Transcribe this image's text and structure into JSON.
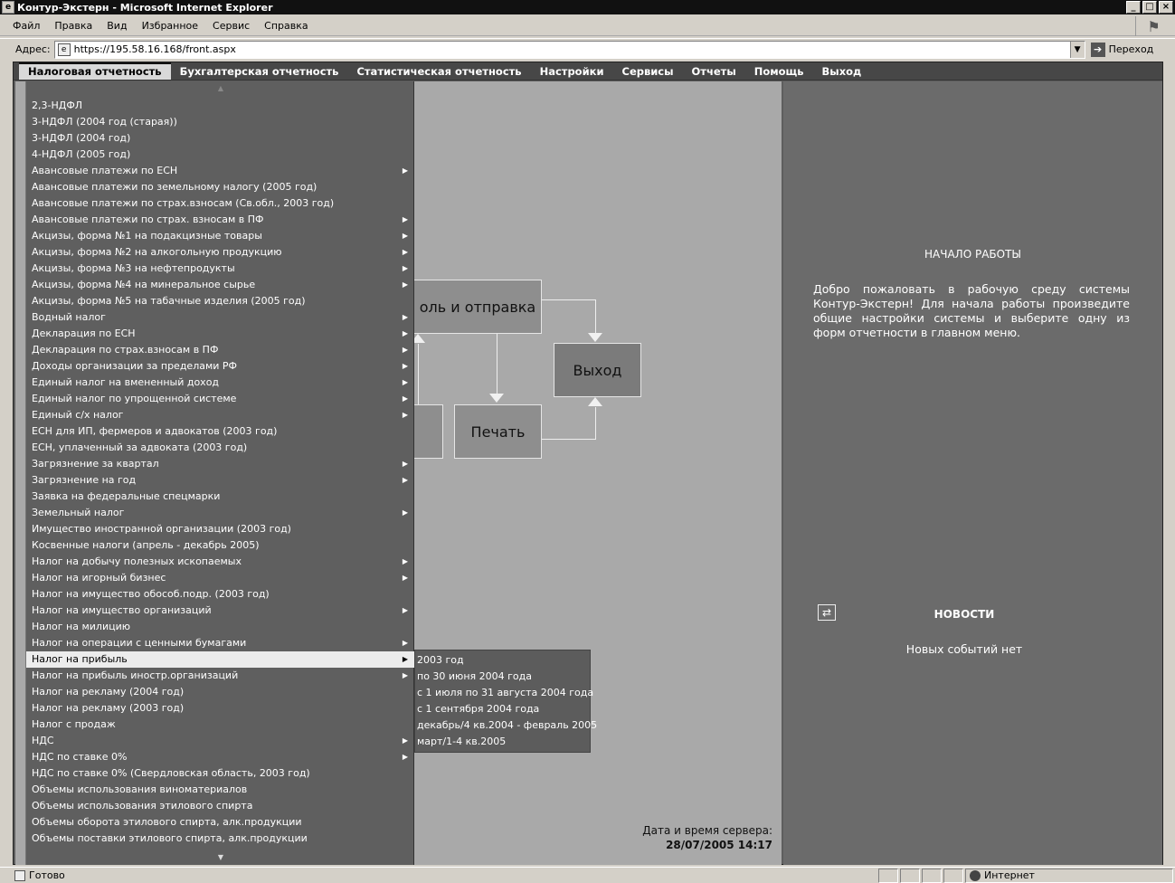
{
  "window": {
    "title": "Контур-Экстерн - Microsoft Internet Explorer",
    "min": "_",
    "max": "□",
    "close": "×"
  },
  "browser_menu": [
    "Файл",
    "Правка",
    "Вид",
    "Избранное",
    "Сервис",
    "Справка"
  ],
  "address": {
    "label": "Адрес:",
    "url": "https://195.58.16.168/front.aspx",
    "go_label": "Переход"
  },
  "top_nav": [
    "Налоговая отчетность",
    "Бухгалтерская отчетность",
    "Статистическая отчетность",
    "Настройки",
    "Сервисы",
    "Отчеты",
    "Помощь",
    "Выход"
  ],
  "diagram": {
    "control_send": "оль и отправка",
    "exit": "Выход",
    "print": "Печать"
  },
  "server_time": {
    "label": "Дата и время сервера:",
    "value": "28/07/2005 14:17"
  },
  "start_panel": {
    "title": "НАЧАЛО РАБОТЫ",
    "text": "Добро пожаловать в рабочую среду системы Контур-Экстерн! Для начала работы произведите общие настройки системы и выберите одну из форм отчетности в главном меню."
  },
  "news": {
    "title": "НОВОСТИ",
    "text": "Новых событий нет"
  },
  "tax_menu": [
    {
      "label": "2,3-НДФЛ",
      "sub": false
    },
    {
      "label": "3-НДФЛ (2004 год (старая))",
      "sub": false
    },
    {
      "label": "3-НДФЛ (2004 год)",
      "sub": false
    },
    {
      "label": "4-НДФЛ (2005 год)",
      "sub": false
    },
    {
      "label": "Авансовые платежи по ЕСН",
      "sub": true
    },
    {
      "label": "Авансовые платежи по земельному налогу (2005 год)",
      "sub": false
    },
    {
      "label": "Авансовые платежи по страх.взносам (Св.обл., 2003 год)",
      "sub": false
    },
    {
      "label": "Авансовые платежи по страх. взносам в ПФ",
      "sub": true
    },
    {
      "label": "Акцизы, форма №1 на подакцизные товары",
      "sub": true
    },
    {
      "label": "Акцизы, форма №2 на алкогольную продукцию",
      "sub": true
    },
    {
      "label": "Акцизы, форма №3 на нефтепродукты",
      "sub": true
    },
    {
      "label": "Акцизы, форма №4 на минеральное сырье",
      "sub": true
    },
    {
      "label": "Акцизы, форма №5 на табачные изделия (2005 год)",
      "sub": false
    },
    {
      "label": "Водный налог",
      "sub": true
    },
    {
      "label": "Декларация по ЕСН",
      "sub": true
    },
    {
      "label": "Декларация по страх.взносам в ПФ",
      "sub": true
    },
    {
      "label": "Доходы организации за пределами РФ",
      "sub": true
    },
    {
      "label": "Единый налог на вмененный доход",
      "sub": true
    },
    {
      "label": "Единый налог по упрощенной системе",
      "sub": true
    },
    {
      "label": "Единый с/х налог",
      "sub": true
    },
    {
      "label": "ЕСН для ИП, фермеров и адвокатов (2003 год)",
      "sub": false
    },
    {
      "label": "ЕСН, уплаченный за адвоката (2003 год)",
      "sub": false
    },
    {
      "label": "Загрязнение за квартал",
      "sub": true
    },
    {
      "label": "Загрязнение на год",
      "sub": true
    },
    {
      "label": "Заявка на федеральные спецмарки",
      "sub": false
    },
    {
      "label": "Земельный налог",
      "sub": true
    },
    {
      "label": "Имущество иностранной организации (2003 год)",
      "sub": false
    },
    {
      "label": "Косвенные налоги (апрель - декабрь 2005)",
      "sub": false
    },
    {
      "label": "Налог на добычу полезных ископаемых",
      "sub": true
    },
    {
      "label": "Налог на игорный бизнес",
      "sub": true
    },
    {
      "label": "Налог на имущество обособ.подр. (2003 год)",
      "sub": false
    },
    {
      "label": "Налог на имущество организаций",
      "sub": true
    },
    {
      "label": "Налог на милицию",
      "sub": false
    },
    {
      "label": "Налог на операции с ценными бумагами",
      "sub": true
    },
    {
      "label": "Налог на прибыль",
      "sub": true,
      "active": true
    },
    {
      "label": "Налог на прибыль иностр.организаций",
      "sub": true
    },
    {
      "label": "Налог на рекламу (2004 год)",
      "sub": false
    },
    {
      "label": "Налог на рекламу (2003 год)",
      "sub": false
    },
    {
      "label": "Налог с продаж",
      "sub": false
    },
    {
      "label": "НДС",
      "sub": true
    },
    {
      "label": "НДС по ставке 0%",
      "sub": true
    },
    {
      "label": "НДС по ставке 0% (Свердловская область, 2003 год)",
      "sub": false
    },
    {
      "label": "Объемы использования виноматериалов",
      "sub": false
    },
    {
      "label": "Объемы использования этилового спирта",
      "sub": false
    },
    {
      "label": "Объемы оборота этилового спирта, алк.продукции",
      "sub": false
    },
    {
      "label": "Объемы поставки этилового спирта, алк.продукции",
      "sub": false
    }
  ],
  "profit_submenu": [
    "2003 год",
    "по 30 июня 2004 года",
    "с 1 июля по 31 августа 2004 года",
    "с 1 сентября 2004 года",
    "декабрь/4 кв.2004 - февраль 2005",
    "март/1-4 кв.2005"
  ],
  "status": {
    "ready": "Готово",
    "zone": "Интернет"
  }
}
